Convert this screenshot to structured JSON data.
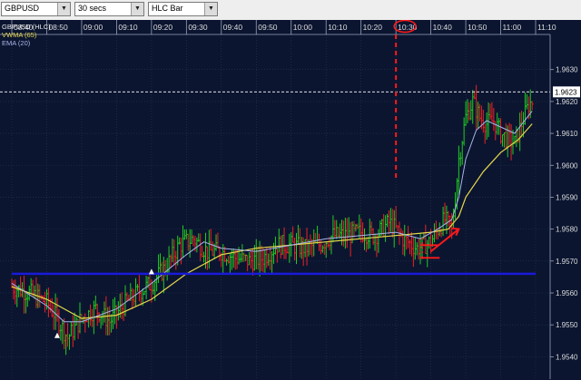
{
  "toolbar": {
    "symbol": "GBPUSD",
    "interval": "30 secs",
    "chart_style": "HLC Bar",
    "dropdown_icon": "chevron-down-icon"
  },
  "legend": {
    "main": "GBPUSD (HLC)",
    "vwma": "VWMA (65)",
    "ema": "EMA (20)"
  },
  "colors": {
    "background": "#0b1530",
    "up_bar": "#22cc22",
    "down_bar": "#ee2222",
    "vwma": "#e6d84a",
    "ema": "#aab6ea",
    "support_line": "#1a1ad8",
    "annotation": "#ff1a1a",
    "last_price_line": "#ffffff"
  },
  "chart_data": {
    "type": "ohlc",
    "time_axis": [
      "08:40",
      "08:50",
      "09:00",
      "09:10",
      "09:20",
      "09:30",
      "09:40",
      "09:50",
      "10:00",
      "10:10",
      "10:20",
      "10:30",
      "10:40",
      "10:50",
      "11:00",
      "11:10"
    ],
    "price_axis": [
      "1.9630",
      "1.9620",
      "1.9610",
      "1.9600",
      "1.9590",
      "1.9580",
      "1.9570",
      "1.9560",
      "1.9550",
      "1.9540"
    ],
    "ylim": [
      1.9533,
      1.9641
    ],
    "last_price": "1.9623",
    "highlighted_time": "10:30",
    "close_path": [
      [
        "08:40",
        1.9562
      ],
      [
        "08:45",
        1.956
      ],
      [
        "08:50",
        1.9557
      ],
      [
        "08:53",
        1.9552
      ],
      [
        "08:56",
        1.9546
      ],
      [
        "09:00",
        1.9552
      ],
      [
        "09:04",
        1.9555
      ],
      [
        "09:08",
        1.9551
      ],
      [
        "09:12",
        1.9556
      ],
      [
        "09:16",
        1.956
      ],
      [
        "09:20",
        1.9563
      ],
      [
        "09:24",
        1.9568
      ],
      [
        "09:28",
        1.9575
      ],
      [
        "09:32",
        1.9577
      ],
      [
        "09:36",
        1.9573
      ],
      [
        "09:40",
        1.9573
      ],
      [
        "09:44",
        1.9571
      ],
      [
        "09:48",
        1.957
      ],
      [
        "09:52",
        1.9571
      ],
      [
        "09:56",
        1.9575
      ],
      [
        "10:00",
        1.9575
      ],
      [
        "10:04",
        1.9574
      ],
      [
        "10:08",
        1.9575
      ],
      [
        "10:12",
        1.9578
      ],
      [
        "10:16",
        1.9578
      ],
      [
        "10:20",
        1.9579
      ],
      [
        "10:24",
        1.9578
      ],
      [
        "10:28",
        1.9582
      ],
      [
        "10:30",
        1.958
      ],
      [
        "10:32",
        1.9577
      ],
      [
        "10:36",
        1.9574
      ],
      [
        "10:40",
        1.9576
      ],
      [
        "10:42",
        1.958
      ],
      [
        "10:44",
        1.9583
      ],
      [
        "10:46",
        1.958
      ],
      [
        "10:47",
        1.959
      ],
      [
        "10:48",
        1.9602
      ],
      [
        "10:50",
        1.9615
      ],
      [
        "10:52",
        1.962
      ],
      [
        "10:54",
        1.9615
      ],
      [
        "10:56",
        1.9613
      ],
      [
        "10:58",
        1.9614
      ],
      [
        "11:00",
        1.961
      ],
      [
        "11:02",
        1.9608
      ],
      [
        "11:04",
        1.9607
      ],
      [
        "11:06",
        1.9613
      ],
      [
        "11:08",
        1.9619
      ],
      [
        "11:09",
        1.962
      ]
    ],
    "vwma_path": [
      [
        "08:40",
        1.9562
      ],
      [
        "08:50",
        1.9558
      ],
      [
        "09:00",
        1.9552
      ],
      [
        "09:10",
        1.9553
      ],
      [
        "09:20",
        1.9558
      ],
      [
        "09:30",
        1.9566
      ],
      [
        "09:40",
        1.9572
      ],
      [
        "09:50",
        1.9574
      ],
      [
        "10:00",
        1.9575
      ],
      [
        "10:10",
        1.9576
      ],
      [
        "10:20",
        1.9577
      ],
      [
        "10:30",
        1.9578
      ],
      [
        "10:40",
        1.9579
      ],
      [
        "10:45",
        1.958
      ],
      [
        "10:48",
        1.9584
      ],
      [
        "10:50",
        1.959
      ],
      [
        "10:55",
        1.9598
      ],
      [
        "11:00",
        1.9604
      ],
      [
        "11:05",
        1.9608
      ],
      [
        "11:09",
        1.9613
      ]
    ],
    "ema_path": [
      [
        "08:40",
        1.9563
      ],
      [
        "08:50",
        1.9556
      ],
      [
        "08:55",
        1.9551
      ],
      [
        "09:00",
        1.9551
      ],
      [
        "09:10",
        1.9555
      ],
      [
        "09:20",
        1.9563
      ],
      [
        "09:30",
        1.9572
      ],
      [
        "09:35",
        1.9576
      ],
      [
        "09:40",
        1.9574
      ],
      [
        "09:50",
        1.9573
      ],
      [
        "10:00",
        1.9575
      ],
      [
        "10:10",
        1.9577
      ],
      [
        "10:20",
        1.9578
      ],
      [
        "10:30",
        1.9579
      ],
      [
        "10:37",
        1.9577
      ],
      [
        "10:42",
        1.958
      ],
      [
        "10:46",
        1.9583
      ],
      [
        "10:48",
        1.959
      ],
      [
        "10:50",
        1.9602
      ],
      [
        "10:53",
        1.9611
      ],
      [
        "10:56",
        1.9614
      ],
      [
        "11:00",
        1.9612
      ],
      [
        "11:04",
        1.961
      ],
      [
        "11:09",
        1.9617
      ]
    ],
    "markers": [
      [
        "08:53",
        1.9547
      ],
      [
        "09:20",
        1.9567
      ]
    ],
    "annotations": {
      "support_price": 1.9566,
      "support_span": [
        "08:40",
        "11:10"
      ],
      "vertical_marker_time": "10:30",
      "bracket": [
        "10:37",
        "10:42",
        1.9571
      ],
      "arrow": [
        [
          "10:40",
          1.9573
        ],
        [
          "10:48",
          1.958
        ]
      ]
    }
  }
}
